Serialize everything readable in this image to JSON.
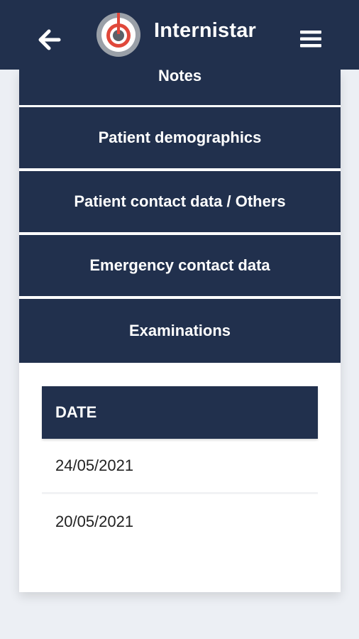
{
  "header": {
    "title": "Internistar",
    "back_icon": "arrow-left-icon",
    "logo_icon": "power-target-logo",
    "menu_icon": "hamburger-menu-icon",
    "colors": {
      "navy": "#21304d",
      "logo_red": "#e0483b",
      "logo_gray": "#9aa0a8"
    }
  },
  "sections": [
    {
      "label": "Notes"
    },
    {
      "label": "Patient demographics"
    },
    {
      "label": "Patient contact data / Others"
    },
    {
      "label": "Emergency contact data"
    },
    {
      "label": "Examinations"
    }
  ],
  "examinations_table": {
    "header": "DATE",
    "rows": [
      "24/05/2021",
      "20/05/2021"
    ]
  }
}
